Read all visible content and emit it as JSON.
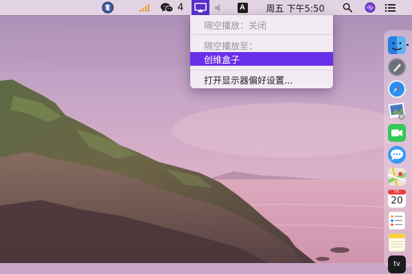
{
  "menubar": {
    "wechat_count": "4",
    "input_source_letter": "A",
    "clock": "周五 下午5:50",
    "icons": [
      "globe-app-icon",
      "signal-bars-icon",
      "wechat-icon",
      "airplay-icon",
      "volume-icon",
      "input-source-icon",
      "spotlight-search-icon",
      "siri-icon",
      "control-list-icon"
    ]
  },
  "airplay_menu": {
    "status": "隔空播放：关闭",
    "header": "隔空播放至：",
    "device": "创维盒子",
    "preferences": "打开显示器偏好设置..."
  },
  "dock": {
    "apps": [
      "finder",
      "launchpad",
      "safari",
      "photo-viewer",
      "facetime",
      "messages",
      "maps",
      "calendar",
      "reminders",
      "notes",
      "apple-tv"
    ],
    "calendar_month": "JUL",
    "calendar_day": "20",
    "tv_label": "tv"
  },
  "colors": {
    "highlight": "#6a2fe8",
    "airplay_active": "#5a2fd0"
  }
}
